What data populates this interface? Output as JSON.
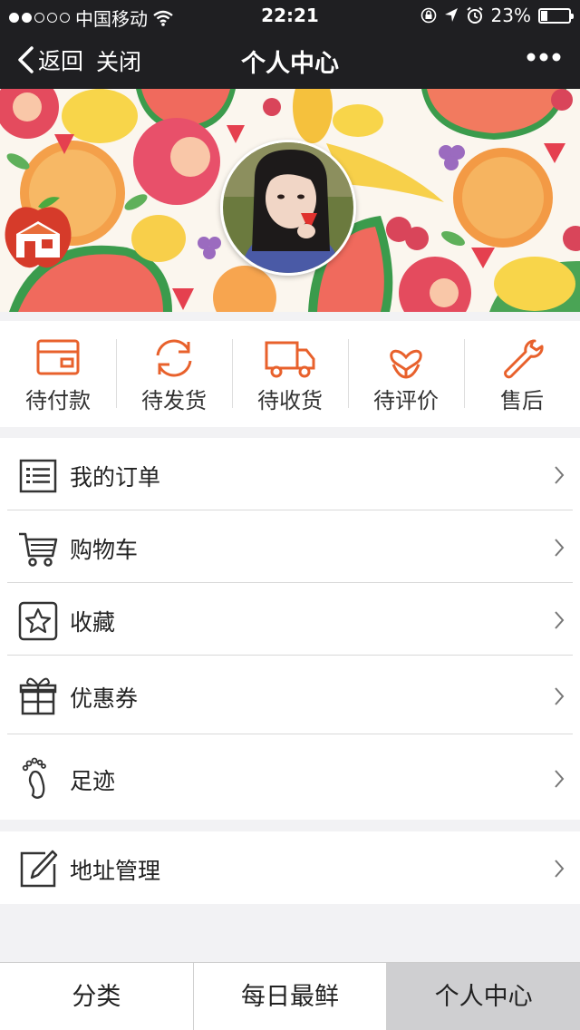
{
  "status_bar": {
    "carrier": "中国移动",
    "time": "22:21",
    "battery": "23%",
    "battery_level": 0.23
  },
  "nav": {
    "back_label": "返回",
    "close_label": "关闭",
    "title": "个人中心",
    "more_icon": "more-icon"
  },
  "orders": [
    {
      "label": "待付款",
      "icon": "wallet-icon"
    },
    {
      "label": "待发货",
      "icon": "refresh-icon"
    },
    {
      "label": "待收货",
      "icon": "truck-icon"
    },
    {
      "label": "待评价",
      "icon": "heart-flower-icon"
    },
    {
      "label": "售后",
      "icon": "wrench-icon"
    }
  ],
  "menu": [
    {
      "label": "我的订单",
      "icon": "order-list-icon"
    },
    {
      "label": "购物车",
      "icon": "cart-icon"
    },
    {
      "label": "收藏",
      "icon": "star-icon"
    },
    {
      "label": "优惠券",
      "icon": "gift-icon"
    },
    {
      "label": "足迹",
      "icon": "footprint-icon"
    }
  ],
  "menu2": [
    {
      "label": "地址管理",
      "icon": "edit-icon"
    }
  ],
  "tabs": [
    {
      "label": "分类",
      "active": false
    },
    {
      "label": "每日最鲜",
      "active": false
    },
    {
      "label": "个人中心",
      "active": true
    }
  ],
  "colors": {
    "accent": "#e8612c",
    "header": "#1f1f22",
    "active_tab": "#cfcfd1"
  }
}
